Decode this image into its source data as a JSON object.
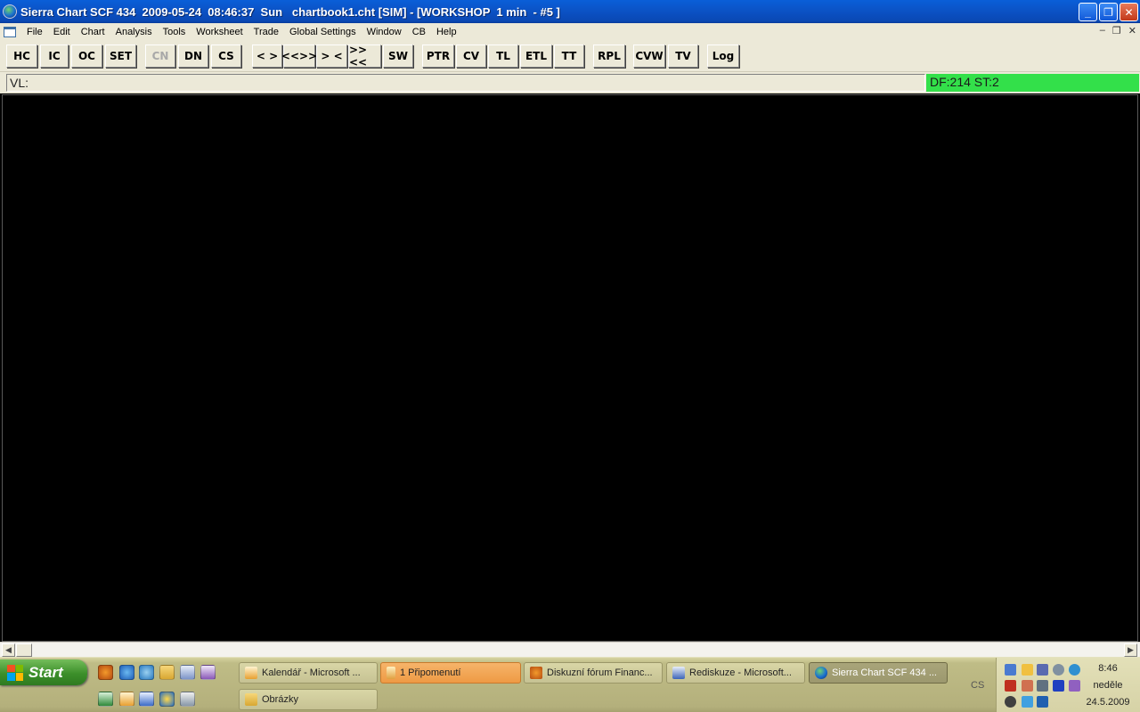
{
  "window": {
    "title": "Sierra Chart SCF 434  2009-05-24  08:46:37  Sun   chartbook1.cht [SIM] - [WORKSHOP  1 min  - #5 ]",
    "minimize_glyph": "_",
    "maximize_glyph": "❐",
    "close_glyph": "✕"
  },
  "menu": {
    "items": [
      "File",
      "Edit",
      "Chart",
      "Analysis",
      "Tools",
      "Worksheet",
      "Trade",
      "Global Settings",
      "Window",
      "CB",
      "Help"
    ],
    "mdi_min": "–",
    "mdi_restore": "❐",
    "mdi_close": "✕"
  },
  "toolbar": {
    "buttons": [
      {
        "label": "HC",
        "enabled": true
      },
      {
        "label": "IC",
        "enabled": true
      },
      {
        "label": "OC",
        "enabled": true
      },
      {
        "label": "SET",
        "enabled": true
      },
      {
        "label": "CN",
        "enabled": false
      },
      {
        "label": "DN",
        "enabled": true
      },
      {
        "label": "CS",
        "enabled": true
      },
      {
        "label": "< >",
        "enabled": true
      },
      {
        "label": "<<>>",
        "enabled": true
      },
      {
        "label": "> <",
        "enabled": true
      },
      {
        "label": ">><<",
        "enabled": true
      },
      {
        "label": "SW",
        "enabled": true
      },
      {
        "label": "PTR",
        "enabled": true
      },
      {
        "label": "CV",
        "enabled": true
      },
      {
        "label": "TL",
        "enabled": true
      },
      {
        "label": "ETL",
        "enabled": true
      },
      {
        "label": "TT",
        "enabled": true
      },
      {
        "label": "RPL",
        "enabled": true
      },
      {
        "label": "CVW",
        "enabled": true
      },
      {
        "label": "TV",
        "enabled": true
      },
      {
        "label": "Log",
        "enabled": true
      }
    ]
  },
  "status": {
    "vl_text": "VL:",
    "df_text": "DF:214  ST:2",
    "df_color": "#33e04a"
  },
  "chart": {
    "background": "#000000"
  },
  "scrollbar": {
    "left_arrow": "◀",
    "right_arrow": "▶"
  },
  "taskbar": {
    "start_label": "Start",
    "buttons": [
      {
        "label": "Kalendář - Microsoft ...",
        "icon": "outlook-calendar-icon",
        "state": "normal"
      },
      {
        "label": "1 Připomenutí",
        "icon": "reminder-icon",
        "state": "flash"
      },
      {
        "label": "Diskuzní fórum Financ...",
        "icon": "firefox-icon",
        "state": "normal"
      },
      {
        "label": "Rediskuze - Microsoft...",
        "icon": "word-icon",
        "state": "normal"
      },
      {
        "label": "Sierra Chart SCF 434 ...",
        "icon": "sierra-chart-icon",
        "state": "active"
      },
      {
        "label": "Obrázky",
        "icon": "folder-icon",
        "state": "normal"
      }
    ],
    "language": "CS",
    "clock_time": "8:46",
    "clock_day": "neděle",
    "clock_date": "24.5.2009"
  }
}
